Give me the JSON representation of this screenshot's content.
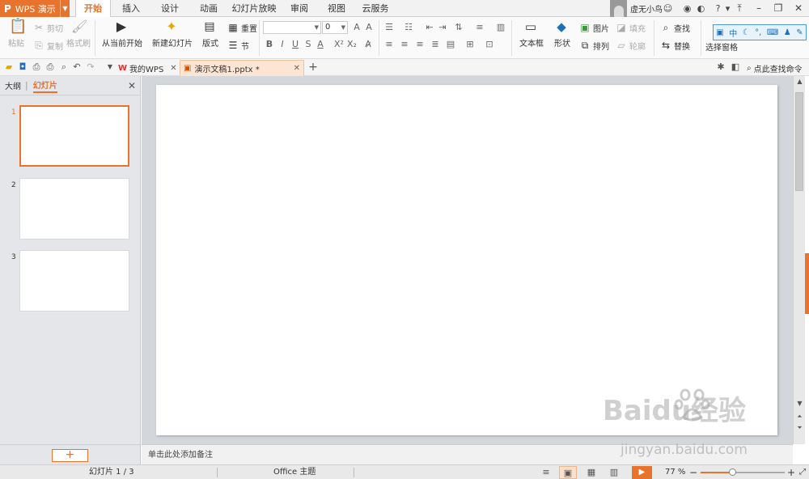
{
  "app": {
    "logo": "P",
    "name": "WPS 演示"
  },
  "tabs": [
    {
      "label": "开始",
      "active": true
    },
    {
      "label": "插入"
    },
    {
      "label": "设计"
    },
    {
      "label": "动画"
    },
    {
      "label": "幻灯片放映"
    },
    {
      "label": "审阅"
    },
    {
      "label": "视图"
    },
    {
      "label": "云服务"
    }
  ],
  "user": {
    "name": "虚无小鸟"
  },
  "ribbon": {
    "paste": "粘贴",
    "cut": "剪切",
    "copy": "复制",
    "format_painter": "格式刷",
    "from_current": "从当前开始",
    "new_slide": "新建幻灯片",
    "layout": "版式",
    "reset": "重置",
    "section": "节",
    "font_name": "",
    "font_size": "0",
    "textbox": "文本框",
    "shape": "形状",
    "picture": "图片",
    "fill": "填充",
    "arrange": "排列",
    "outline": "轮廓",
    "find": "查找",
    "replace": "替换",
    "selection_pane": "选择窗格",
    "pinyin_panel": "中"
  },
  "quick_access": {
    "doc_tabs": [
      {
        "label": "我的WPS",
        "icon": "wps-logo-icon"
      },
      {
        "label": "演示文稿1.pptx *",
        "icon": "presentation-file-icon",
        "active": true
      }
    ],
    "search_label": "点此查找命令"
  },
  "left_panel": {
    "tab_outline": "大纲",
    "tab_slides": "幻灯片",
    "slides": [
      {
        "num": "1",
        "selected": true
      },
      {
        "num": "2"
      },
      {
        "num": "3"
      }
    ],
    "add_button": "+"
  },
  "notes_placeholder": "单击此处添加备注",
  "status": {
    "slide_info": "幻灯片 1 / 3",
    "theme": "Office 主题",
    "zoom": "77 %",
    "zoom_value": 77
  },
  "watermark": {
    "line1": "Baidu经验",
    "line2": "jingyan.baidu.com"
  },
  "colors": {
    "accent": "#e8732d",
    "canvas_bg": "#d3d6db",
    "panel_bg": "#e4e6ea"
  }
}
